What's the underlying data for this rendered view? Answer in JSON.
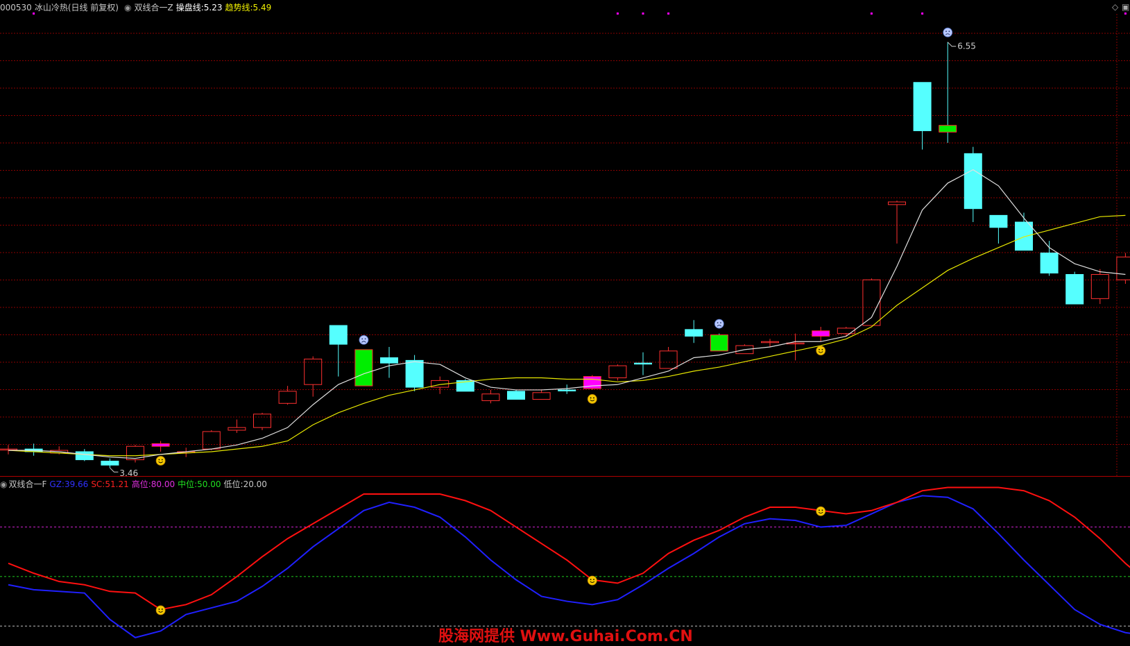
{
  "main_header": {
    "code": "000530",
    "name": "冰山冷热(日线 前复权)",
    "indicator": "双线合一Z",
    "line1_label": "操盘线:",
    "line1_value": "5.23",
    "line2_label": "趋势线:",
    "line2_value": "5.49"
  },
  "sub_header": {
    "indicator": "双线合一F",
    "gz_label": "GZ:",
    "gz_value": "39.66",
    "sc_label": "SC:",
    "sc_value": "51.21",
    "high_label": "高位:",
    "high_value": "80.00",
    "mid_label": "中位:",
    "mid_value": "50.00",
    "low_label": "低位:",
    "low_value": "20.00"
  },
  "corner_icons": [
    "diamond-icon",
    "window-icon"
  ],
  "watermark": "股海网提供 Www.Guhai.Com.CN",
  "colors": {
    "up": "#ff3030",
    "down": "#55ffff",
    "signal_up": "#ff00ff",
    "signal_down": "#00ee00",
    "line_operate": "#e0e0e0",
    "line_trend": "#e8e800",
    "gz": "#2020ff",
    "sc": "#ff1010",
    "high": "#d020d0",
    "mid": "#20d020",
    "low": "#c0c0c0",
    "grid": "#8b0000"
  },
  "chart_data": [
    {
      "type": "candlestick",
      "price_range": [
        3.35,
        6.75
      ],
      "high_label": "6.55",
      "low_label": "3.46",
      "candles": [
        {
          "o": 3.52,
          "c": 3.52,
          "h": 3.55,
          "l": 3.48,
          "kind": "up"
        },
        {
          "o": 3.52,
          "c": 3.5,
          "h": 3.56,
          "l": 3.47,
          "kind": "down"
        },
        {
          "o": 3.49,
          "c": 3.51,
          "h": 3.54,
          "l": 3.48,
          "kind": "up"
        },
        {
          "o": 3.5,
          "c": 3.44,
          "h": 3.52,
          "l": 3.43,
          "kind": "down"
        },
        {
          "o": 3.43,
          "c": 3.4,
          "h": 3.45,
          "l": 3.38,
          "kind": "down"
        },
        {
          "o": 3.44,
          "c": 3.54,
          "h": 3.55,
          "l": 3.42,
          "kind": "up"
        },
        {
          "o": 3.54,
          "c": 3.56,
          "h": 3.58,
          "l": 3.5,
          "kind": "sigup"
        },
        {
          "o": 3.5,
          "c": 3.5,
          "h": 3.53,
          "l": 3.46,
          "kind": "up"
        },
        {
          "o": 3.52,
          "c": 3.65,
          "h": 3.66,
          "l": 3.51,
          "kind": "up"
        },
        {
          "o": 3.66,
          "c": 3.68,
          "h": 3.74,
          "l": 3.64,
          "kind": "up"
        },
        {
          "o": 3.68,
          "c": 3.78,
          "h": 3.79,
          "l": 3.66,
          "kind": "up"
        },
        {
          "o": 3.86,
          "c": 3.95,
          "h": 3.99,
          "l": 3.85,
          "kind": "up"
        },
        {
          "o": 4.0,
          "c": 4.19,
          "h": 4.21,
          "l": 3.91,
          "kind": "up"
        },
        {
          "o": 4.44,
          "c": 4.3,
          "h": 4.44,
          "l": 4.06,
          "kind": "down"
        },
        {
          "o": 4.26,
          "c": 3.99,
          "h": 4.26,
          "l": 3.99,
          "kind": "sigdown"
        },
        {
          "o": 4.2,
          "c": 4.16,
          "h": 4.28,
          "l": 4.05,
          "kind": "down"
        },
        {
          "o": 4.18,
          "c": 3.98,
          "h": 4.22,
          "l": 3.95,
          "kind": "down"
        },
        {
          "o": 3.98,
          "c": 4.03,
          "h": 4.06,
          "l": 3.93,
          "kind": "up"
        },
        {
          "o": 4.03,
          "c": 3.95,
          "h": 4.04,
          "l": 3.95,
          "kind": "down"
        },
        {
          "o": 3.88,
          "c": 3.93,
          "h": 3.96,
          "l": 3.86,
          "kind": "up"
        },
        {
          "o": 3.95,
          "c": 3.89,
          "h": 3.96,
          "l": 3.89,
          "kind": "down"
        },
        {
          "o": 3.89,
          "c": 3.94,
          "h": 3.96,
          "l": 3.89,
          "kind": "up"
        },
        {
          "o": 3.96,
          "c": 3.96,
          "h": 4.0,
          "l": 3.93,
          "kind": "down"
        },
        {
          "o": 3.97,
          "c": 4.06,
          "h": 4.07,
          "l": 3.96,
          "kind": "sigup"
        },
        {
          "o": 4.05,
          "c": 4.14,
          "h": 4.15,
          "l": 4.03,
          "kind": "up"
        },
        {
          "o": 4.16,
          "c": 4.16,
          "h": 4.24,
          "l": 4.07,
          "kind": "down"
        },
        {
          "o": 4.12,
          "c": 4.25,
          "h": 4.28,
          "l": 4.12,
          "kind": "up"
        },
        {
          "o": 4.41,
          "c": 4.36,
          "h": 4.48,
          "l": 4.31,
          "kind": "down"
        },
        {
          "o": 4.37,
          "c": 4.25,
          "h": 4.38,
          "l": 4.25,
          "kind": "sigdown"
        },
        {
          "o": 4.23,
          "c": 4.29,
          "h": 4.3,
          "l": 4.23,
          "kind": "up"
        },
        {
          "o": 4.32,
          "c": 4.32,
          "h": 4.34,
          "l": 4.28,
          "kind": "up"
        },
        {
          "o": 4.31,
          "c": 4.31,
          "h": 4.38,
          "l": 4.18,
          "kind": "up"
        },
        {
          "o": 4.36,
          "c": 4.4,
          "h": 4.43,
          "l": 4.32,
          "kind": "sigup"
        },
        {
          "o": 4.38,
          "c": 4.42,
          "h": 4.43,
          "l": 4.36,
          "kind": "up"
        },
        {
          "o": 4.44,
          "c": 4.78,
          "h": 4.79,
          "l": 4.44,
          "kind": "up"
        },
        {
          "o": 5.36,
          "c": 5.34,
          "h": 5.37,
          "l": 5.05,
          "kind": "up"
        },
        {
          "o": 6.25,
          "c": 5.89,
          "h": 6.25,
          "l": 5.75,
          "kind": "down"
        },
        {
          "o": 5.88,
          "c": 5.93,
          "h": 6.55,
          "l": 5.8,
          "kind": "sigdown"
        },
        {
          "o": 5.72,
          "c": 5.31,
          "h": 5.77,
          "l": 5.21,
          "kind": "down"
        },
        {
          "o": 5.26,
          "c": 5.17,
          "h": 5.26,
          "l": 5.05,
          "kind": "down"
        },
        {
          "o": 5.21,
          "c": 5.0,
          "h": 5.28,
          "l": 5.0,
          "kind": "down"
        },
        {
          "o": 4.98,
          "c": 4.83,
          "h": 5.07,
          "l": 4.81,
          "kind": "down"
        },
        {
          "o": 4.82,
          "c": 4.6,
          "h": 4.84,
          "l": 4.6,
          "kind": "down"
        },
        {
          "o": 4.64,
          "c": 4.82,
          "h": 4.86,
          "l": 4.6,
          "kind": "up"
        },
        {
          "o": 4.78,
          "c": 4.95,
          "h": 4.98,
          "l": 4.75,
          "kind": "up"
        }
      ],
      "operate_line": [
        3.51,
        3.51,
        3.5,
        3.48,
        3.46,
        3.45,
        3.48,
        3.5,
        3.52,
        3.55,
        3.6,
        3.68,
        3.85,
        4.0,
        4.08,
        4.14,
        4.17,
        4.15,
        4.05,
        3.98,
        3.96,
        3.96,
        3.97,
        3.99,
        4.0,
        4.05,
        4.1,
        4.2,
        4.22,
        4.26,
        4.28,
        4.32,
        4.32,
        4.36,
        4.5,
        4.88,
        5.3,
        5.5,
        5.6,
        5.48,
        5.24,
        5.02,
        4.9,
        4.84,
        4.82
      ],
      "trend_line": [
        3.51,
        3.5,
        3.49,
        3.48,
        3.47,
        3.47,
        3.48,
        3.49,
        3.5,
        3.52,
        3.54,
        3.58,
        3.7,
        3.79,
        3.86,
        3.92,
        3.96,
        4.0,
        4.02,
        4.04,
        4.05,
        4.05,
        4.04,
        4.04,
        4.02,
        4.03,
        4.06,
        4.1,
        4.13,
        4.17,
        4.21,
        4.25,
        4.29,
        4.34,
        4.43,
        4.59,
        4.72,
        4.85,
        4.94,
        5.02,
        5.1,
        5.15,
        5.2,
        5.25,
        5.26
      ],
      "smile_markers": [
        6,
        23,
        32
      ],
      "sad_markers": [
        14,
        28,
        37
      ],
      "top_ticks": [
        1,
        24,
        25,
        26,
        34,
        36,
        44
      ]
    },
    {
      "type": "line",
      "y_range": [
        10,
        100
      ],
      "levels": {
        "high": 80,
        "mid": 50,
        "low": 20
      },
      "series": [
        {
          "name": "GZ",
          "values": [
            45,
            42,
            41,
            40,
            24,
            13,
            17,
            27,
            31,
            35,
            44,
            55,
            68,
            79,
            90,
            95,
            92,
            86,
            74,
            60,
            48,
            38,
            35,
            33,
            36,
            45,
            55,
            64,
            74,
            82,
            85,
            84,
            80,
            81,
            88,
            95,
            99,
            98,
            91,
            76,
            60,
            45,
            30,
            21,
            16,
            14
          ]
        },
        {
          "name": "SC",
          "values": [
            58,
            52,
            47,
            45,
            41,
            40,
            30,
            33,
            39,
            50,
            62,
            73,
            82,
            91,
            100,
            100,
            100,
            100,
            96,
            90,
            80,
            70,
            60,
            48,
            46,
            52,
            64,
            72,
            78,
            86,
            92,
            92,
            90,
            88,
            90,
            95,
            102,
            104,
            104,
            104,
            102,
            96,
            86,
            73,
            58,
            45
          ]
        }
      ],
      "smile_markers": [
        6,
        23,
        32
      ]
    }
  ]
}
